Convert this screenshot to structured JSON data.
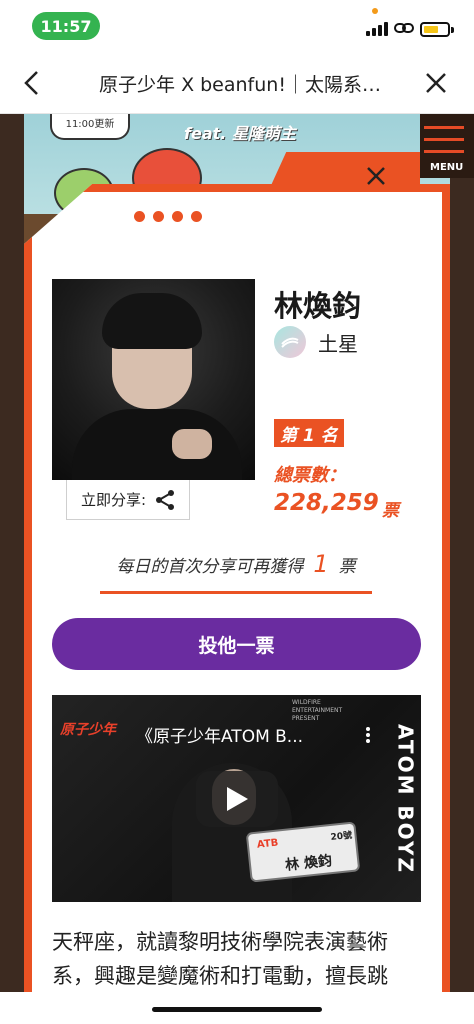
{
  "status_bar": {
    "time": "11:57"
  },
  "nav": {
    "title": "原子少年 X beanfun!｜太陽系…"
  },
  "banner": {
    "bubble_text": "11:00更新",
    "feat_text": "feat. 星隆萌主"
  },
  "menu": {
    "label": "MENU"
  },
  "profile": {
    "name": "林煥鈞",
    "planet": "土星",
    "rank": "第 1 名",
    "total_label": "總票數：",
    "total_votes": "228,259",
    "votes_unit": "票",
    "share_label": "立即分享:"
  },
  "daily": {
    "text": "每日的首次分享可再獲得",
    "count": "1",
    "unit": "票"
  },
  "vote_button": {
    "label": "投他一票"
  },
  "video": {
    "title": "《原子少年ATOM B...",
    "side_text": "ATOM BOYZ",
    "small_text": "WILDFIRE ENTERTAINMENT PRESENT",
    "ticket_code": "ATB",
    "ticket_name": "林 煥鈞",
    "ticket_number": "20號"
  },
  "description": "天秤座，就讀黎明技術學院表演藝術系，興趣是變魔術和打電動，擅長跳",
  "colors": {
    "accent": "#ea5223",
    "vote_button": "#6a2ca0",
    "status_pill": "#34b350"
  }
}
